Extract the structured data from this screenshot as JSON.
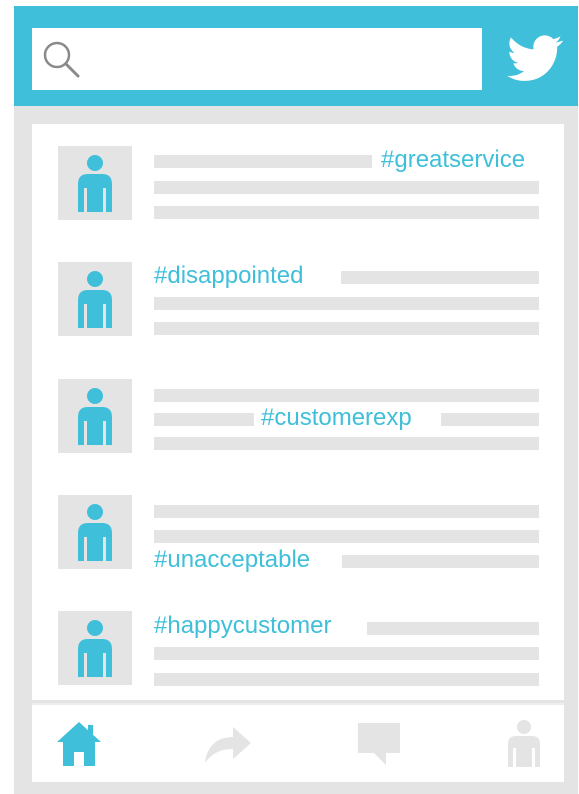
{
  "header": {
    "brand_icon": "twitter-bird-icon",
    "search_icon": "search-icon",
    "search_value": "",
    "search_placeholder": ""
  },
  "feed": {
    "tweets": [
      {
        "hashtag": "#greatservice",
        "avatar_icon": "user-icon"
      },
      {
        "hashtag": "#disappointed",
        "avatar_icon": "user-icon"
      },
      {
        "hashtag": "#customerexp",
        "avatar_icon": "user-icon"
      },
      {
        "hashtag": "#unacceptable",
        "avatar_icon": "user-icon"
      },
      {
        "hashtag": "#happycustomer",
        "avatar_icon": "user-icon"
      }
    ]
  },
  "bottom_nav": {
    "items": [
      "home-icon",
      "retweet-icon",
      "messages-icon",
      "profile-icon"
    ],
    "active": "home-icon"
  },
  "colors": {
    "accent": "#3fbfd9",
    "placeholder_bar": "#e4e4e4",
    "inactive_icon": "#e4e4e4",
    "background": "#ffffff"
  }
}
